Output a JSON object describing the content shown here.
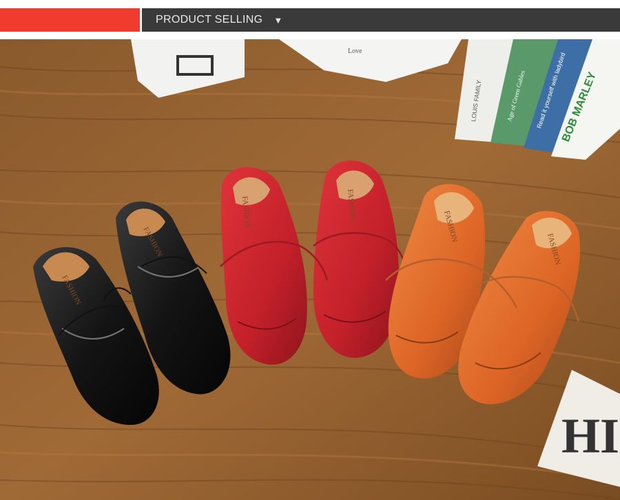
{
  "header": {
    "title": "PRODUCT SELLING",
    "arrow_icon": "triangle-down-icon",
    "red_color": "#f03c2e",
    "dark_color": "#3a3a3a"
  },
  "photo": {
    "props": {
      "book_1_spine": "BOB MARLEY",
      "book_2_spine": "Read it yourself with ladybird",
      "book_3_spine": "Age of Green Gables",
      "book_4_spine": "LOUIS FAMILY",
      "box_text": "Love",
      "sign_letters": "HI"
    },
    "shoe_insole_text": "FASHION",
    "shoe_colors": {
      "black": "#1b1b1b",
      "red": "#c9242c",
      "orange": "#e0692a"
    }
  }
}
